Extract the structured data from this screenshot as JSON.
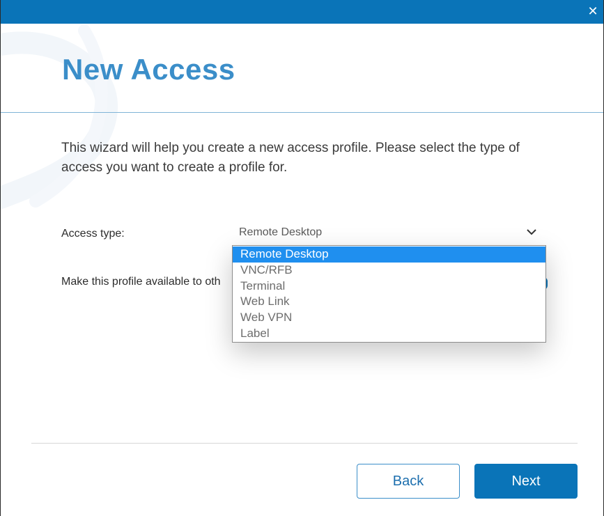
{
  "window": {
    "close_glyph": "✕",
    "accent_color": "#0a74b8"
  },
  "header": {
    "title": "New Access"
  },
  "intro": {
    "text": "This wizard will help you create a new access profile. Please select the type of access you want to create a profile for."
  },
  "form": {
    "access_type_label": "Access type:",
    "access_type_value": "Remote Desktop",
    "availability_label": "Make this profile available to oth",
    "access_type_options": [
      {
        "label": "Remote Desktop",
        "selected": true
      },
      {
        "label": "VNC/RFB",
        "selected": false
      },
      {
        "label": "Terminal",
        "selected": false
      },
      {
        "label": "Web Link",
        "selected": false
      },
      {
        "label": "Web VPN",
        "selected": false
      },
      {
        "label": "Label",
        "selected": false
      }
    ]
  },
  "footer": {
    "back_label": "Back",
    "next_label": "Next"
  },
  "icons": {
    "close": "close-icon",
    "dropdown": "chevron-down-icon",
    "watermark": "logo-watermark"
  }
}
